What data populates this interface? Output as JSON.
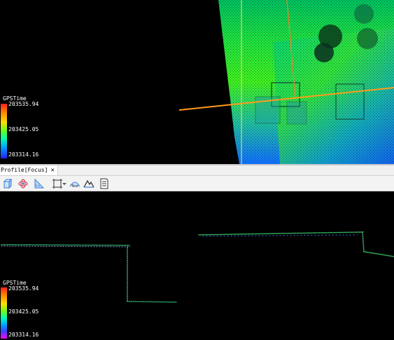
{
  "view3d": {
    "legend": {
      "title": "GPSTime",
      "max": "203535.94",
      "mid": "203425.05",
      "min": "203314.16"
    }
  },
  "profile_tab": {
    "label": "Profile[Focus]",
    "close": "✕"
  },
  "toolbar": {
    "buttons": [
      {
        "name": "cube-view-icon"
      },
      {
        "name": "orbit-icon"
      },
      {
        "name": "measure-icon"
      },
      {
        "name": "grid-icon"
      },
      {
        "name": "text-icon"
      },
      {
        "name": "terrain-icon"
      },
      {
        "name": "document-icon"
      }
    ]
  },
  "profile": {
    "legend": {
      "title": "GPSTime",
      "max": "203535.94",
      "mid": "203425.05",
      "min": "203314.16"
    }
  },
  "colors": {
    "profile_line": "#ff9b1a",
    "grid_line": "#d8d86a"
  }
}
